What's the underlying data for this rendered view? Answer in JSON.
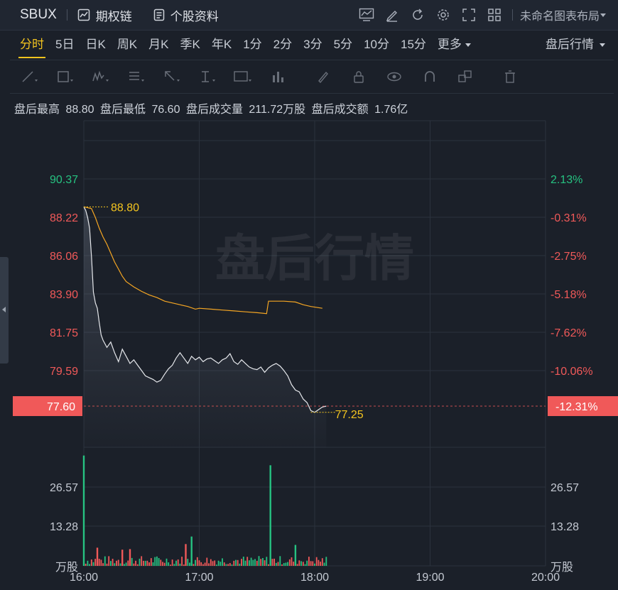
{
  "toolbar": {
    "ticker": "SBUX",
    "options_label": "期权链",
    "profile_label": "个股资料",
    "layout_label": "未命名图表布局"
  },
  "periods": [
    "分时",
    "5日",
    "日K",
    "周K",
    "月K",
    "季K",
    "年K",
    "1分",
    "2分",
    "3分",
    "5分",
    "10分",
    "15分"
  ],
  "more_label": "更多",
  "session_select": "盘后行情",
  "stats": {
    "high_label": "盘后最高",
    "high": "88.80",
    "low_label": "盘后最低",
    "low": "76.60",
    "vol_label": "盘后成交量",
    "vol": "211.72万股",
    "amt_label": "盘后成交额",
    "amt": "1.76亿"
  },
  "colors": {
    "up": "#26c281",
    "down": "#f05959",
    "price_line": "#e6e8ec",
    "avg_line": "#f5a623",
    "highlight": "#f3c41f",
    "bg": "#1b2029"
  },
  "chart_data": {
    "type": "line",
    "watermark": "盘后行情",
    "x_ticks": [
      "16:00",
      "17:00",
      "18:00",
      "19:00",
      "20:00"
    ],
    "x_range": [
      "16:00",
      "20:00"
    ],
    "ylim": [
      77.6,
      90.37
    ],
    "price_ticks": [
      "90.37",
      "88.22",
      "86.06",
      "83.90",
      "81.75",
      "79.59",
      "77.60"
    ],
    "pct_ticks": [
      "2.13%",
      "-0.31%",
      "-2.75%",
      "-5.18%",
      "-7.62%",
      "-10.06%",
      "-12.31%"
    ],
    "last_price_label": "77.60",
    "last_pct_label": "-12.31%",
    "high_marker": {
      "time": "16:00",
      "value": 88.8,
      "label": "88.80"
    },
    "low_marker": {
      "time": "17:58",
      "value": 77.25,
      "label": "77.25"
    },
    "series": [
      {
        "values_time": [
          "16:00",
          "16:01",
          "16:02",
          "16:03",
          "16:04",
          "16:05",
          "16:06",
          "16:07",
          "16:08",
          "16:09",
          "16:10",
          "16:12",
          "16:14",
          "16:16",
          "16:18",
          "16:20",
          "16:22",
          "16:24",
          "16:26",
          "16:28",
          "16:30",
          "16:32",
          "16:34",
          "16:36",
          "16:38",
          "16:40",
          "16:42",
          "16:44",
          "16:46",
          "16:48",
          "16:50",
          "16:52",
          "16:54",
          "16:56",
          "16:58",
          "17:00",
          "17:02",
          "17:04",
          "17:06",
          "17:08",
          "17:10",
          "17:12",
          "17:14",
          "17:16",
          "17:18",
          "17:20",
          "17:22",
          "17:24",
          "17:26",
          "17:28",
          "17:30",
          "17:32",
          "17:34",
          "17:36",
          "17:38",
          "17:40",
          "17:42",
          "17:44",
          "17:46",
          "17:48",
          "17:50",
          "17:52",
          "17:54",
          "17:56",
          "17:58",
          "18:00",
          "18:02",
          "18:04",
          "18:06"
        ],
        "values": [
          88.8,
          88.6,
          88.2,
          87.6,
          86.0,
          84.0,
          83.4,
          83.1,
          82.3,
          81.6,
          81.3,
          80.9,
          81.2,
          80.6,
          80.1,
          80.8,
          80.4,
          80.0,
          80.2,
          79.9,
          79.6,
          79.3,
          79.2,
          79.1,
          78.95,
          79.05,
          79.4,
          79.7,
          79.9,
          80.3,
          80.6,
          80.3,
          80.0,
          80.4,
          80.2,
          80.35,
          80.1,
          80.25,
          80.3,
          80.15,
          80.0,
          80.2,
          80.3,
          80.55,
          80.1,
          79.95,
          80.2,
          80.0,
          79.8,
          79.7,
          79.65,
          79.8,
          79.5,
          79.75,
          79.9,
          80.0,
          79.85,
          79.6,
          79.3,
          78.8,
          78.5,
          78.4,
          78.0,
          77.8,
          77.35,
          77.25,
          77.4,
          77.55,
          77.6
        ]
      },
      {
        "values_time": [
          "16:00",
          "16:04",
          "16:06",
          "16:08",
          "16:10",
          "16:12",
          "16:14",
          "16:16",
          "16:18",
          "16:20",
          "16:22",
          "16:26",
          "16:30",
          "16:34",
          "16:38",
          "16:42",
          "16:46",
          "16:50",
          "16:54",
          "16:58",
          "17:00",
          "17:06",
          "17:12",
          "17:18",
          "17:24",
          "17:30",
          "17:35",
          "17:36",
          "17:38",
          "17:44",
          "17:50",
          "17:54",
          "17:58",
          "18:04"
        ],
        "values": [
          88.8,
          88.7,
          88.2,
          87.6,
          87.1,
          86.7,
          86.2,
          85.7,
          85.3,
          84.9,
          84.6,
          84.3,
          84.05,
          83.85,
          83.7,
          83.5,
          83.4,
          83.3,
          83.2,
          83.05,
          83.1,
          83.05,
          83.0,
          82.95,
          82.9,
          82.85,
          82.8,
          83.5,
          83.5,
          83.5,
          83.45,
          83.3,
          83.2,
          83.1
        ]
      }
    ],
    "volume": {
      "unit_label": "万股",
      "ticks": [
        "26.57",
        "13.28"
      ],
      "ylim": [
        0,
        39.9
      ],
      "spikes": [
        {
          "time": "16:00",
          "value": 39.5,
          "dir": "up"
        },
        {
          "time": "17:37",
          "value": 36.0,
          "dir": "up"
        },
        {
          "time": "16:56",
          "value": 10.5,
          "dir": "up"
        },
        {
          "time": "16:53",
          "value": 7.8,
          "dir": "down"
        },
        {
          "time": "17:50",
          "value": 7.5,
          "dir": "up"
        },
        {
          "time": "16:07",
          "value": 6.5,
          "dir": "down"
        },
        {
          "time": "16:20",
          "value": 5.8,
          "dir": "down"
        },
        {
          "time": "16:24",
          "value": 6.0,
          "dir": "down"
        }
      ]
    }
  }
}
